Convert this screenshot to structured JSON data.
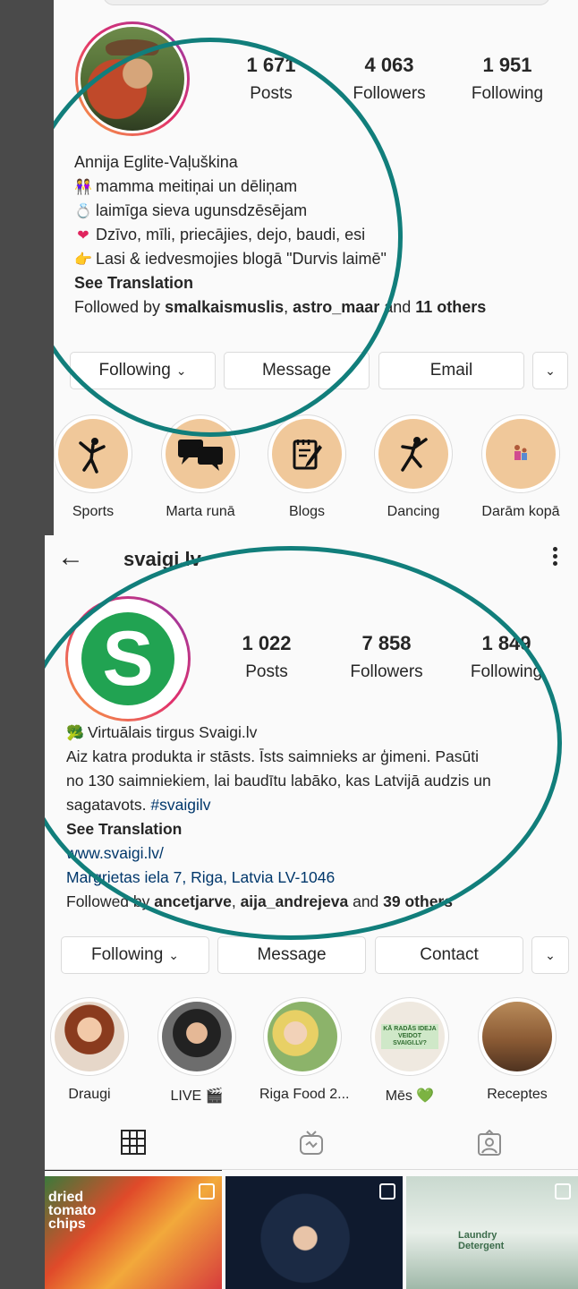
{
  "colors": {
    "accent_annotation": "#117e7b",
    "link": "#00376b",
    "highlight_bg": "#f0c89a",
    "svaigi_green": "#21a352"
  },
  "profile1": {
    "stats": [
      {
        "value": "1 671",
        "label": "Posts"
      },
      {
        "value": "4 063",
        "label": "Followers"
      },
      {
        "value": "1 951",
        "label": "Following"
      }
    ],
    "name": "Annija Eglite-Vaļuškina",
    "bio_lines": [
      {
        "icon": "👭",
        "text": "mamma meitiņai un dēliņam"
      },
      {
        "icon": "💍",
        "text": "laimīga sieva ugunsdzēsējam"
      },
      {
        "icon": "❤",
        "text": "Dzīvo, mīli, priecājies, dejo, baudi, esi"
      },
      {
        "icon": "👉",
        "text": "Lasi & iedvesmojies blogā \"Durvis laimē\""
      }
    ],
    "see_translation": "See Translation",
    "followed_by": {
      "prefix": "Followed by ",
      "user1": "smalkaismuslis",
      "sep": ", ",
      "user2": "astro_maar",
      "and": " and ",
      "others": "11 others"
    },
    "buttons": {
      "following": "Following",
      "message": "Message",
      "email": "Email"
    },
    "highlights": [
      {
        "label": "Sports",
        "icon": "yoga-pose-icon"
      },
      {
        "label": "Marta runā",
        "icon": "speech-bubbles-icon"
      },
      {
        "label": "Blogs",
        "icon": "notepad-pencil-icon"
      },
      {
        "label": "Dancing",
        "icon": "dancer-icon"
      },
      {
        "label": "Darām kopā",
        "icon": "family-icon"
      }
    ]
  },
  "profile2": {
    "username": "svaigi.lv",
    "stats": [
      {
        "value": "1 022",
        "label": "Posts"
      },
      {
        "value": "7 858",
        "label": "Followers"
      },
      {
        "value": "1 849",
        "label": "Following"
      }
    ],
    "name": "Virtuālais tirgus Svaigi.lv",
    "name_icon": "🥦",
    "bio_lines": [
      "Aiz katra produkta ir stāsts. Īsts saimnieks ar ģimeni. Pasūti",
      "no 130 saimniekiem, lai baudītu labāko, kas Latvijā audzis un",
      "sagatavots. "
    ],
    "hashtag": "#svaigilv",
    "see_translation": "See Translation",
    "website": "www.svaigi.lv/",
    "address": "Margrietas iela 7, Riga, Latvia LV-1046",
    "followed_by": {
      "prefix": "Followed by ",
      "user1": "ancetjarve",
      "sep": ", ",
      "user2": "aija_andrejeva",
      "and": " and ",
      "others": "39 others"
    },
    "buttons": {
      "following": "Following",
      "message": "Message",
      "contact": "Contact"
    },
    "highlights": [
      {
        "label": "Draugi"
      },
      {
        "label": "LIVE 🎬"
      },
      {
        "label": "Riga Food 2..."
      },
      {
        "label": "Mēs 💚"
      },
      {
        "label": "Receptes"
      }
    ],
    "highlight_badge_text": "KĀ RADĀS IDEJA VEIDOT SVAIGI.LV?",
    "thumb_texts": [
      "dried tomato chips",
      "Laundry Detergent"
    ]
  }
}
